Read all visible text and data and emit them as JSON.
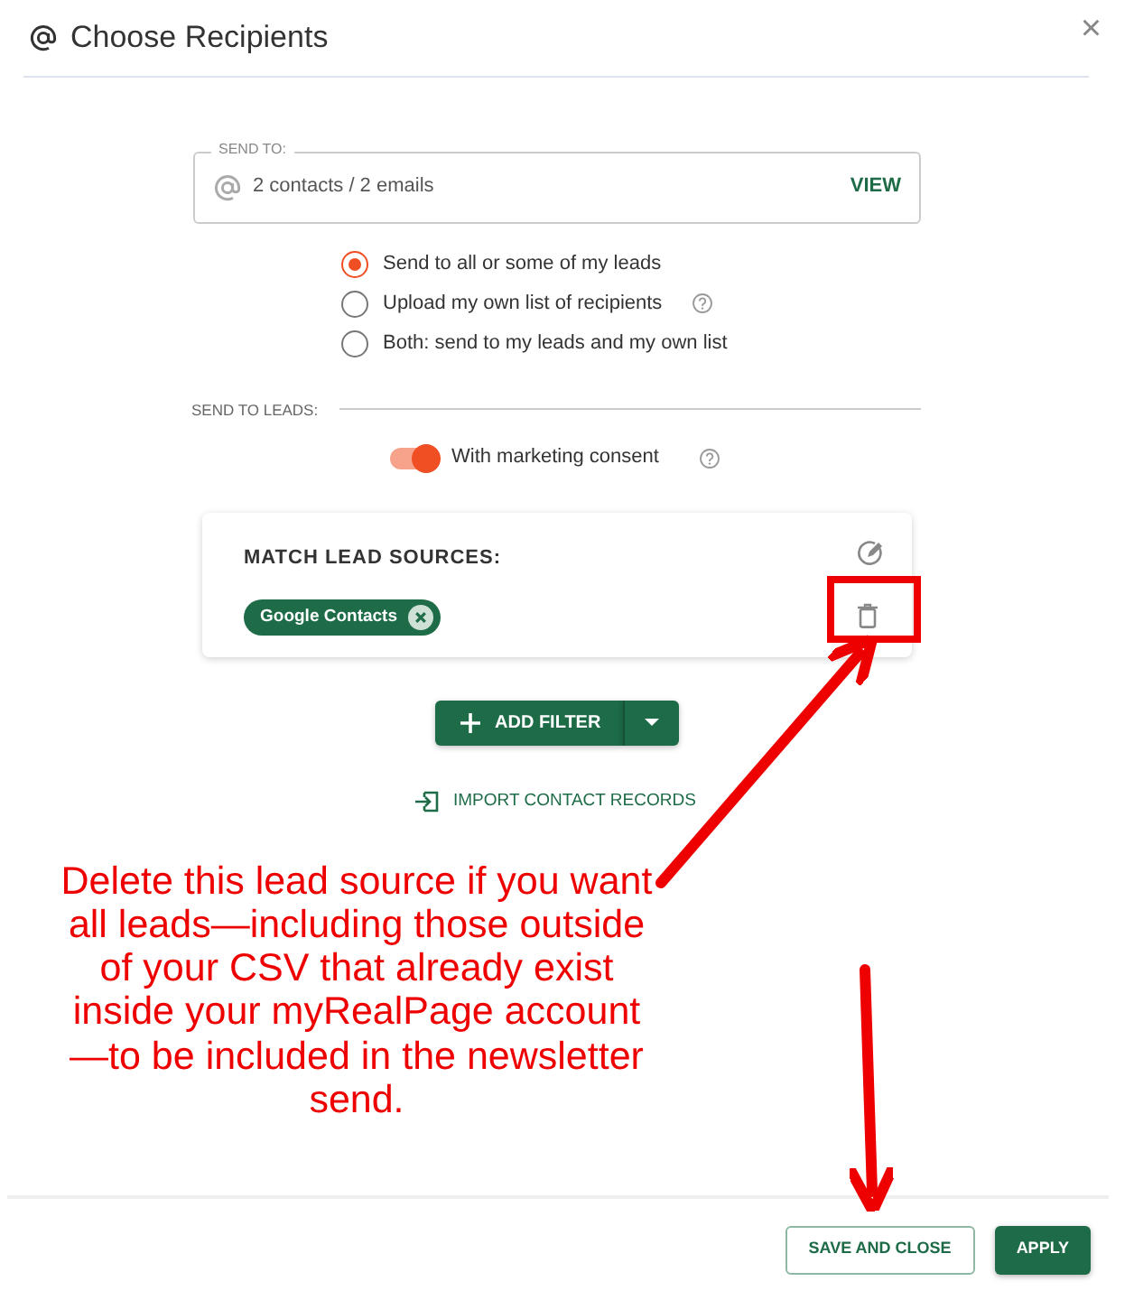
{
  "dialog": {
    "title": "Choose Recipients",
    "close": "×",
    "send_to": {
      "label": "SEND TO:",
      "value": "2 contacts / 2 emails",
      "action": "VIEW"
    },
    "options": [
      {
        "label": "Send to all or some of my leads",
        "selected": true,
        "help": false
      },
      {
        "label": "Upload my own list of recipients",
        "selected": false,
        "help": true
      },
      {
        "label": "Both: send to my leads and my own list",
        "selected": false,
        "help": false
      }
    ],
    "section_label": "SEND TO LEADS:",
    "consent_toggle": {
      "label": "With marketing consent",
      "on": true
    },
    "lead_sources": {
      "title": "MATCH LEAD SOURCES:",
      "tags": [
        {
          "label": "Google Contacts"
        }
      ]
    },
    "add_filter": "ADD FILTER",
    "import_link": "IMPORT CONTACT RECORDS",
    "buttons": [
      {
        "label": "SAVE AND CLOSE",
        "kind": "outline"
      },
      {
        "label": "APPLY",
        "kind": "primary"
      }
    ]
  },
  "annotation": {
    "text": "Delete this lead source if you want all leads—including those outside of your CSV that already exist inside your myRealPage account—to be included in the newsletter send."
  }
}
